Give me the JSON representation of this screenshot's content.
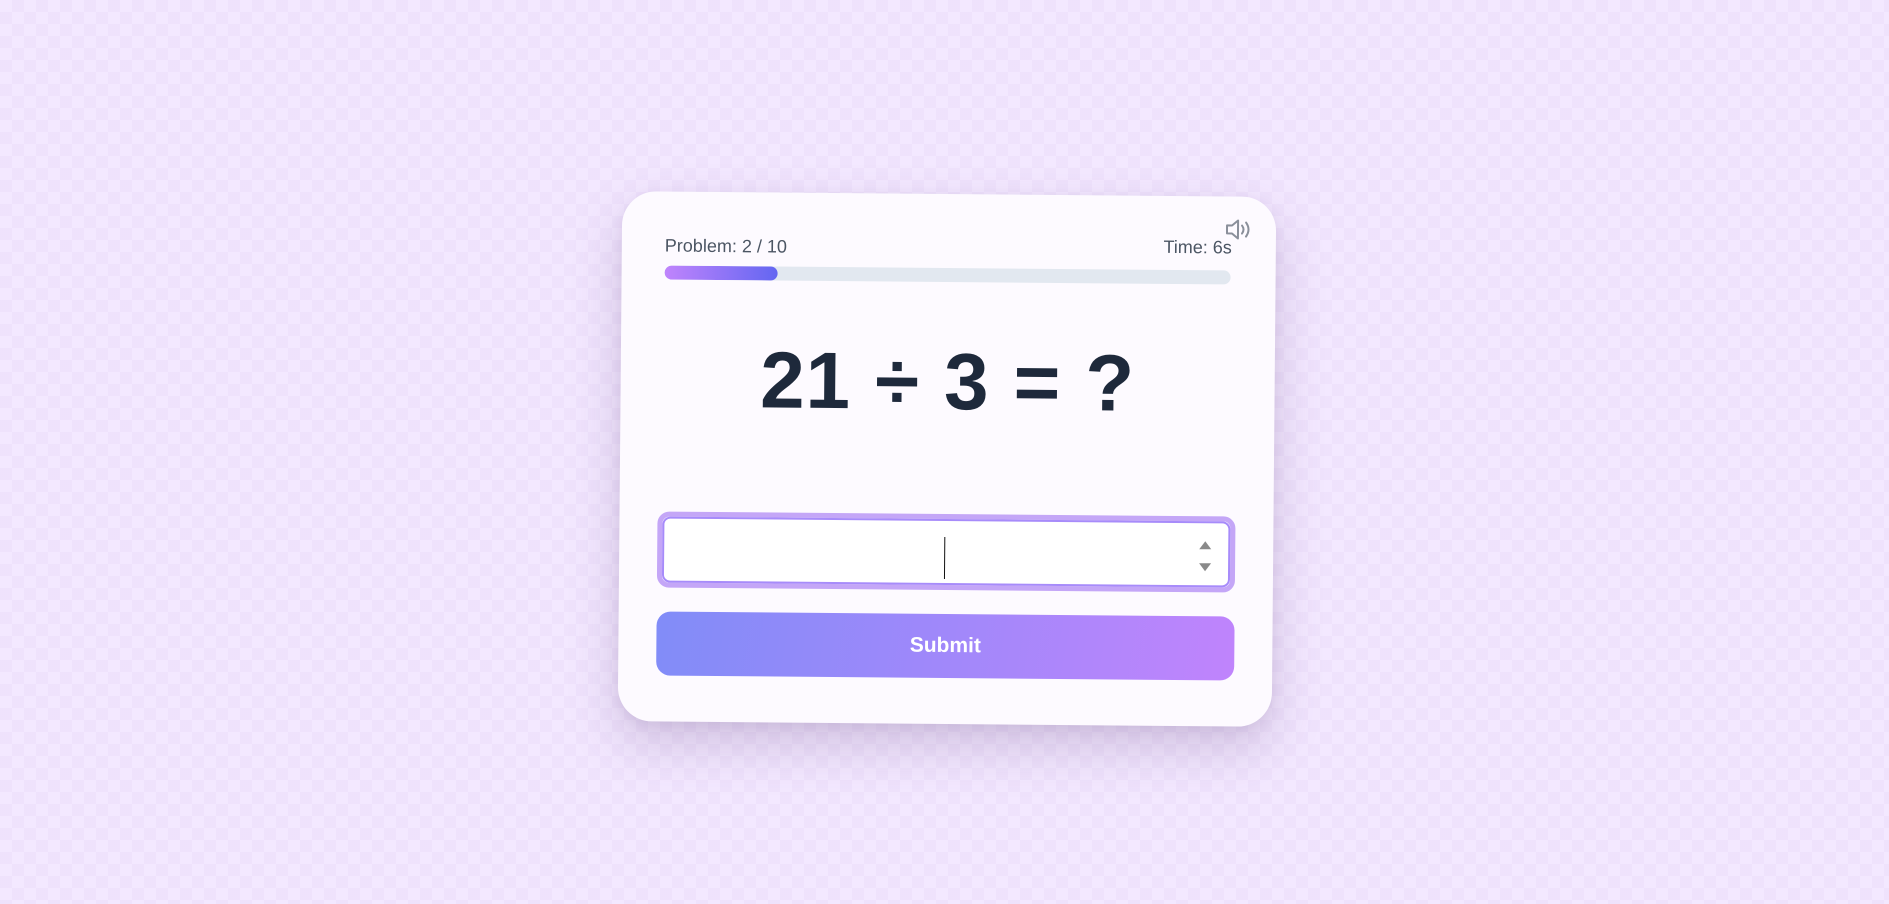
{
  "header": {
    "problem_label": "Problem: 2 / 10",
    "time_label": "Time: 6s",
    "sound_icon": "speaker-volume-icon"
  },
  "progress": {
    "fraction": 0.2
  },
  "equation": {
    "left_operand": "21",
    "operator": "÷",
    "right_operand": "3",
    "equals": "=",
    "unknown": "?"
  },
  "answer": {
    "value": "",
    "placeholder": ""
  },
  "submit": {
    "label": "Submit"
  },
  "colors": {
    "background": "#f3e8ff",
    "card": "#fdfaff",
    "text": "#1e293b",
    "progress_track": "#e2e8f0",
    "progress_start": "#c084fc",
    "progress_end": "#6366f1",
    "submit_start": "#818cf8",
    "submit_end": "#c084fc",
    "input_border": "#c4a6f7"
  }
}
